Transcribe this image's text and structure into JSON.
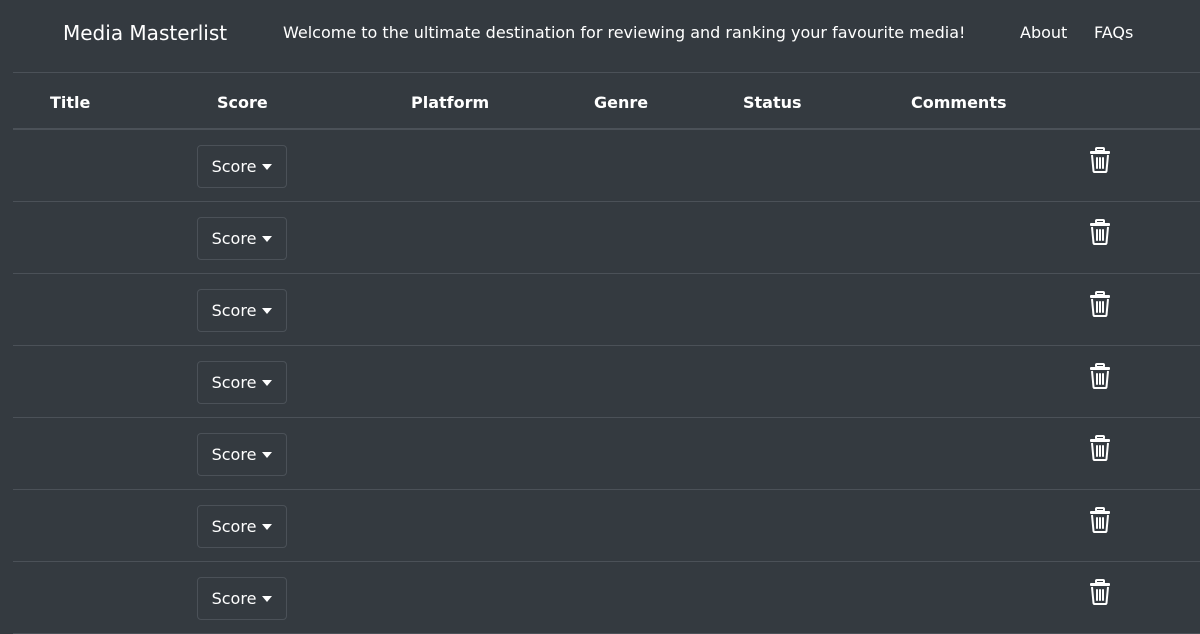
{
  "navbar": {
    "brand": "Media Masterlist",
    "tagline": "Welcome to the ultimate destination for reviewing and ranking your favourite media!",
    "links": [
      "About",
      "FAQs"
    ]
  },
  "table": {
    "headers": {
      "title": "Title",
      "score": "Score",
      "platform": "Platform",
      "genre": "Genre",
      "status": "Status",
      "comments": "Comments"
    },
    "rows": [
      {
        "score_label": "Score",
        "delete_icon": "trash-icon"
      },
      {
        "score_label": "Score",
        "delete_icon": "trash-icon"
      },
      {
        "score_label": "Score",
        "delete_icon": "trash-icon"
      },
      {
        "score_label": "Score",
        "delete_icon": "trash-icon"
      },
      {
        "score_label": "Score",
        "delete_icon": "trash-icon"
      },
      {
        "score_label": "Score",
        "delete_icon": "trash-icon"
      },
      {
        "score_label": "Score",
        "delete_icon": "trash-icon"
      }
    ]
  },
  "colors": {
    "background": "#343a40",
    "border": "#4b5158",
    "text": "#ffffff"
  }
}
